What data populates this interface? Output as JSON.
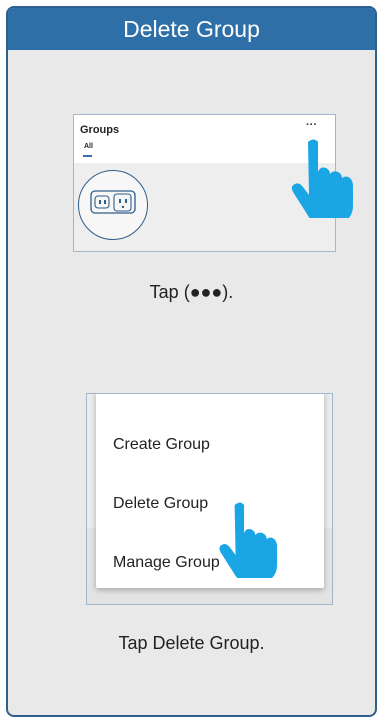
{
  "header": {
    "title": "Delete Group"
  },
  "step1": {
    "screen": {
      "title": "Groups",
      "more_glyph": "···",
      "tab_all": "All"
    },
    "caption": "Tap (●●●)."
  },
  "step2": {
    "menu": {
      "items": [
        {
          "label": "Create Group"
        },
        {
          "label": "Delete Group"
        },
        {
          "label": "Manage Group"
        }
      ]
    },
    "caption_prefix": "Tap ",
    "caption_bold": "Delete Group",
    "caption_suffix": "."
  },
  "colors": {
    "header_bg": "#2e6fa8",
    "card_border": "#2d5f8f",
    "hand": "#1aa6e4"
  },
  "icons": {
    "hand": "pointing-hand-icon",
    "device": "smart-plug-icon"
  }
}
